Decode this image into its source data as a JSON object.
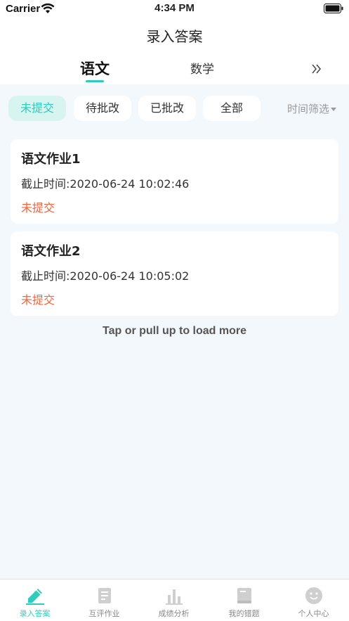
{
  "status_bar": {
    "carrier": "Carrier",
    "time": "4:34 PM"
  },
  "nav": {
    "title": "录入答案"
  },
  "subject_tabs": [
    {
      "label": "语文",
      "active": true
    },
    {
      "label": "数学",
      "active": false
    }
  ],
  "filters": [
    {
      "label": "未提交",
      "active": true
    },
    {
      "label": "待批改",
      "active": false
    },
    {
      "label": "已批改",
      "active": false
    },
    {
      "label": "全部",
      "active": false
    }
  ],
  "time_filter": "时间筛选",
  "assignments": [
    {
      "title": "语文作业1",
      "deadline": "截止时间:2020-06-24 10:02:46",
      "status": "未提交"
    },
    {
      "title": "语文作业2",
      "deadline": "截止时间:2020-06-24 10:05:02",
      "status": "未提交"
    }
  ],
  "load_more": "Tap or pull up to load more",
  "tab_bar": [
    {
      "label": "录入答案",
      "icon": "pencil-icon",
      "active": true
    },
    {
      "label": "互评作业",
      "icon": "document-icon",
      "active": false
    },
    {
      "label": "成绩分析",
      "icon": "bar-chart-icon",
      "active": false
    },
    {
      "label": "我的错题",
      "icon": "book-icon",
      "active": false
    },
    {
      "label": "个人中心",
      "icon": "smiley-icon",
      "active": false
    }
  ],
  "colors": {
    "accent": "#2ecdbb",
    "status_pending": "#f0643c",
    "background": "#f3f8fc"
  }
}
